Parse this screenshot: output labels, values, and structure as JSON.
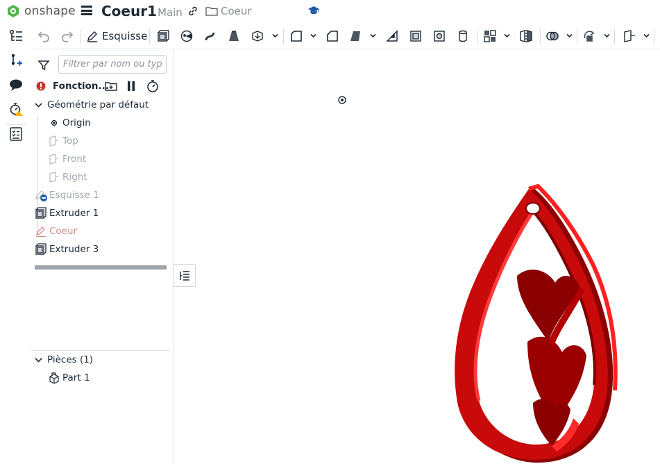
{
  "app": {
    "brand": "onshape",
    "document_title": "Coeur1",
    "branch": "Main",
    "folder": "Coeur"
  },
  "toolbar": {
    "sketch_label": "Esquisse"
  },
  "feature_panel": {
    "search_placeholder": "Filtrer par nom ou type",
    "header_label": "Fonction...",
    "default_geometry_label": "Géométrie par défaut",
    "default_geometry_items": [
      "Origin",
      "Top",
      "Front",
      "Right"
    ],
    "features": [
      {
        "label": "Esquisse 1",
        "kind": "sketch",
        "state": "suppressed"
      },
      {
        "label": "Extruder 1",
        "kind": "extrude",
        "state": "normal"
      },
      {
        "label": "Coeur",
        "kind": "sketch",
        "state": "error"
      },
      {
        "label": "Extruder 3",
        "kind": "extrude",
        "state": "normal"
      }
    ],
    "parts_header": "Pièces (1)",
    "parts": [
      "Part 1"
    ]
  },
  "colors": {
    "model_red": "#d10a0a",
    "model_dark": "#8b0000",
    "model_edge": "#ff3a3a",
    "brand_green": "#4fb548",
    "accent_blue": "#1c5aa8"
  },
  "icons": [
    "onshape-logo-icon",
    "menu-icon",
    "link-icon",
    "folder-icon",
    "learning-center-icon",
    "feature-list-icon",
    "insert-icon",
    "comment-icon",
    "variable-icon",
    "checklist-icon",
    "undo-icon",
    "redo-icon",
    "sketch-pencil-icon",
    "extrude-icon",
    "revolve-icon",
    "sweep-icon",
    "loft-icon",
    "thicken-icon",
    "fillet-icon",
    "chamfer-icon",
    "draft-icon",
    "rib-icon",
    "shell-icon",
    "hole-icon",
    "cylinder-icon",
    "pattern-icon",
    "mirror-icon",
    "boolean-icon",
    "transform-icon",
    "plane-icon",
    "filter-icon",
    "error-icon",
    "add-folder-icon",
    "pause-icon",
    "rollback-timer-icon",
    "chevron-down-icon",
    "part-icon",
    "view-cube-pivot-icon",
    "collapse-panel-icon"
  ]
}
